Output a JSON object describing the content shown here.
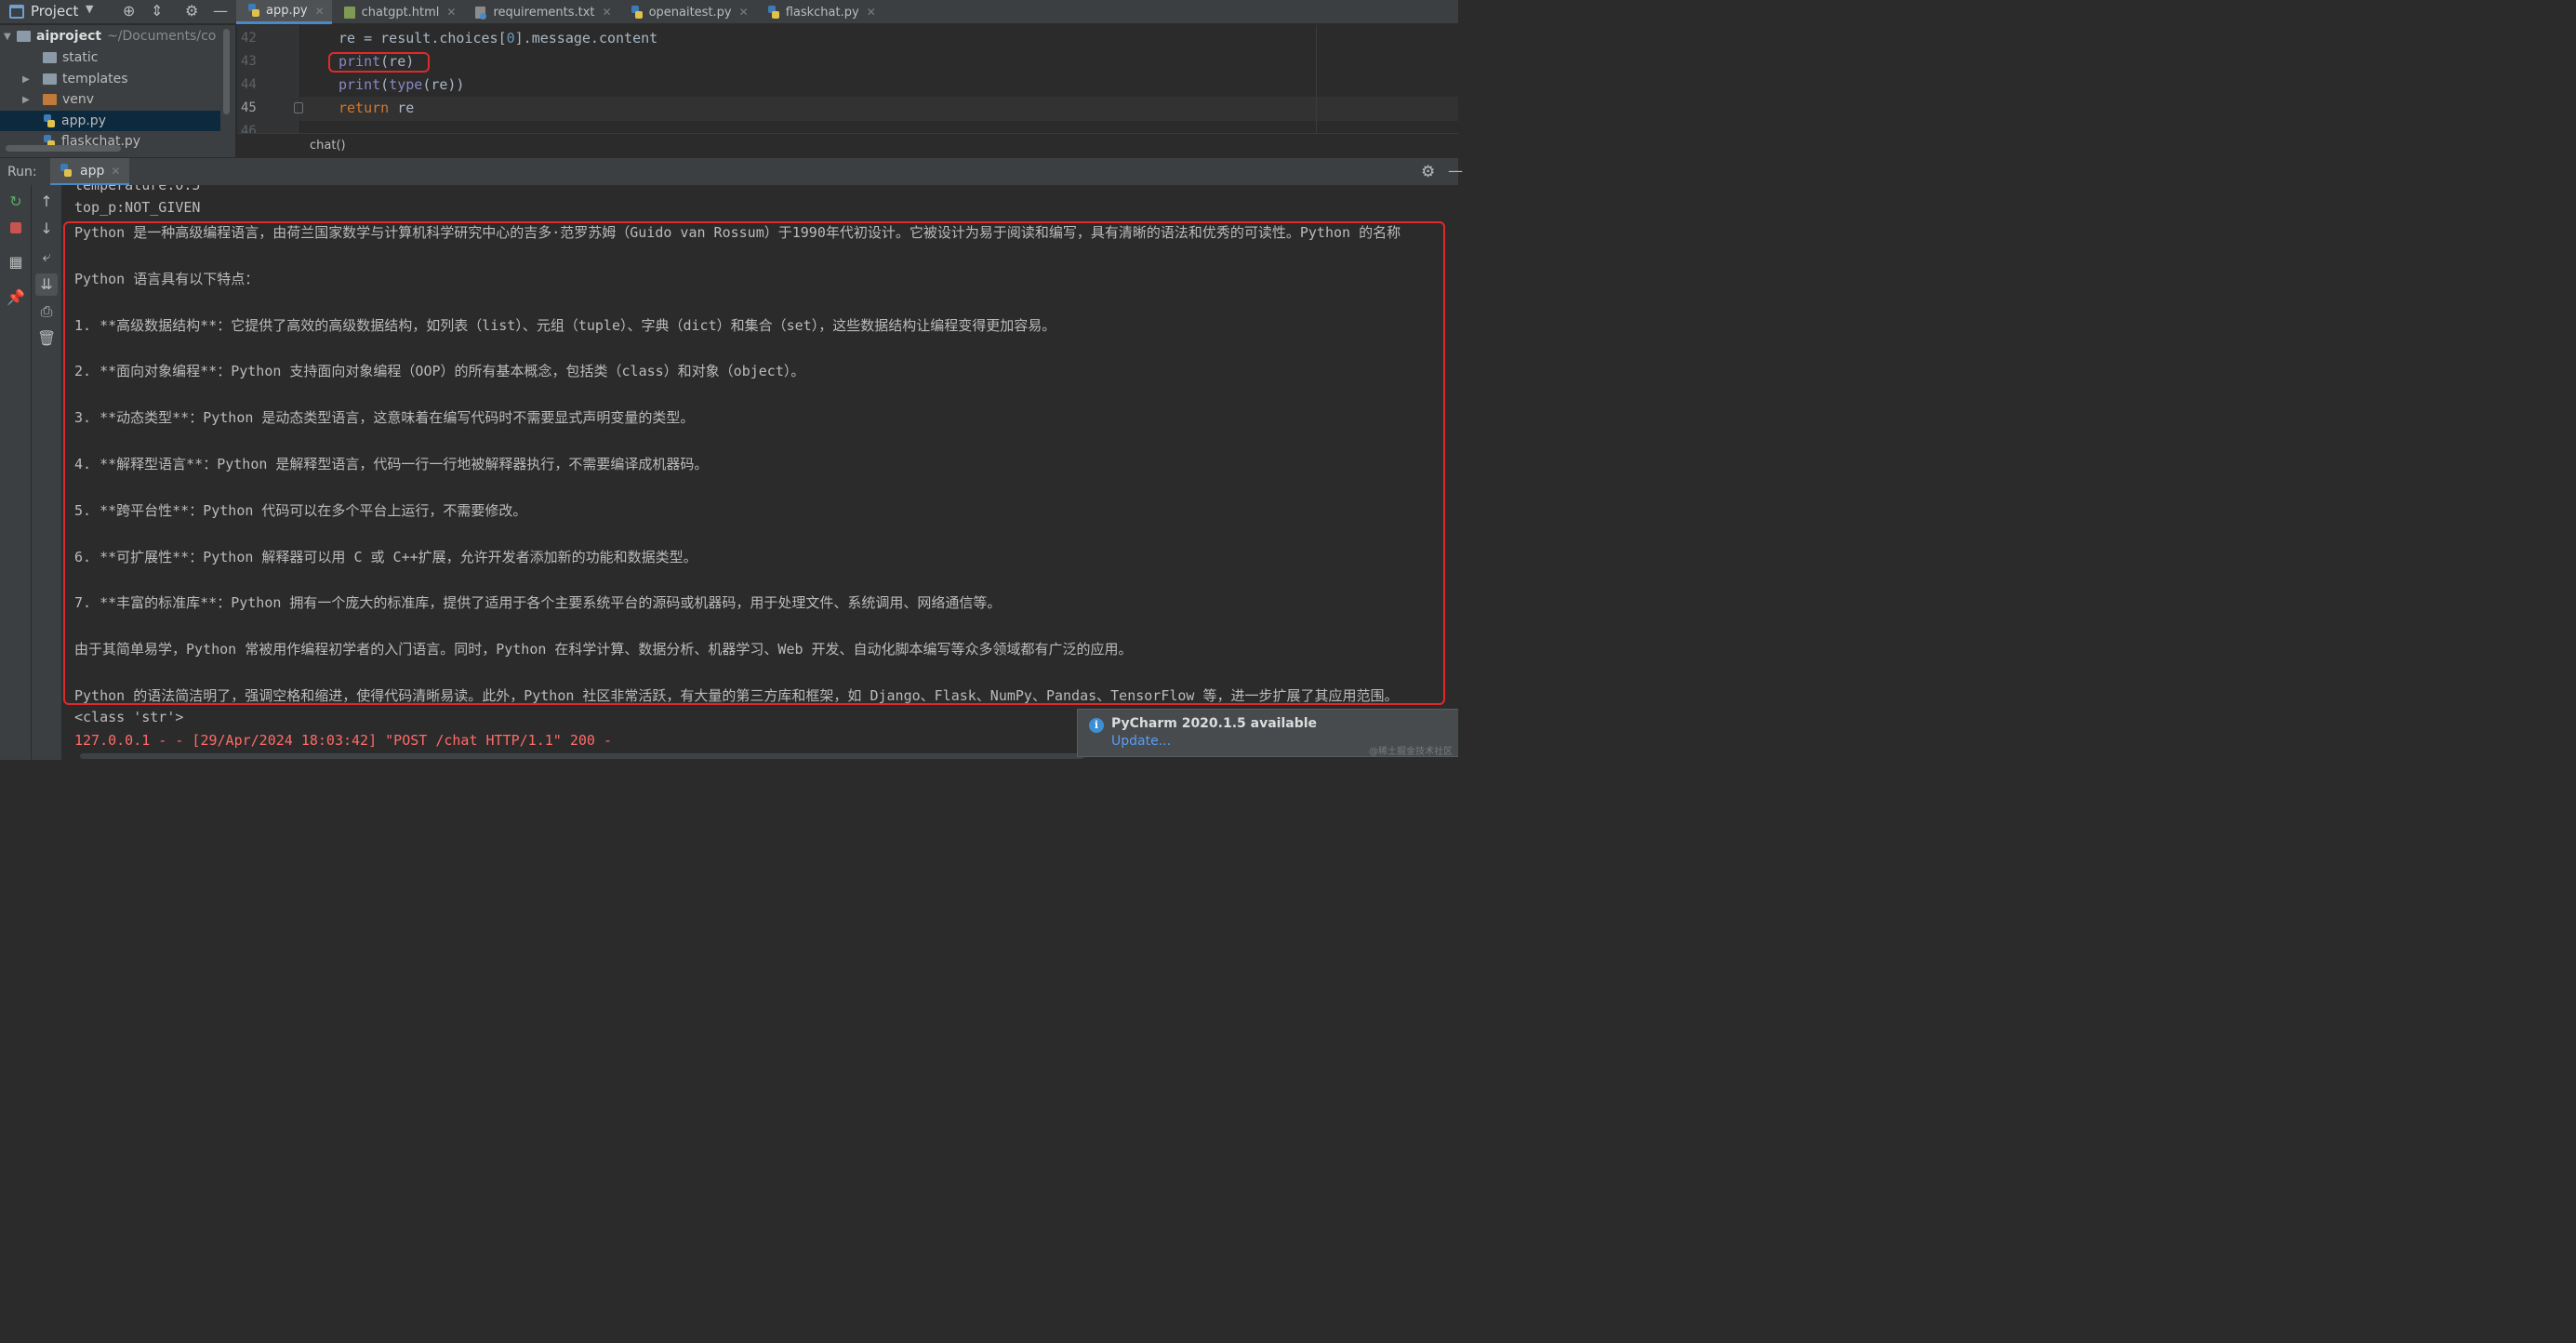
{
  "project_view": {
    "title": "Project",
    "tree": [
      {
        "label": "aiproject",
        "path": "~/Documents/co"
      },
      {
        "label": "static"
      },
      {
        "label": "templates"
      },
      {
        "label": "venv"
      },
      {
        "label": "app.py"
      },
      {
        "label": "flaskchat.py"
      }
    ]
  },
  "tabs": [
    {
      "label": "app.py",
      "icon": "python-file-icon",
      "active": true
    },
    {
      "label": "chatgpt.html",
      "icon": "html-file-icon"
    },
    {
      "label": "requirements.txt",
      "icon": "text-file-icon"
    },
    {
      "label": "openaitest.py",
      "icon": "python-file-icon"
    },
    {
      "label": "flaskchat.py",
      "icon": "python-file-icon"
    }
  ],
  "editor": {
    "line_numbers": [
      "42",
      "43",
      "44",
      "45",
      "46"
    ],
    "code": {
      "l42_pre": "re = result.choices[",
      "l42_num": "0",
      "l42_post": "].message.content",
      "l43_fn": "print",
      "l43_rest": "(re)",
      "l44_fn1": "print",
      "l44_mid": "(",
      "l44_fn2": "type",
      "l44_rest": "(re))",
      "l45_kw": "return",
      "l45_rest": " re"
    },
    "breadcrumb": "chat()"
  },
  "run": {
    "label": "Run:",
    "tab": "app",
    "console": {
      "partial_line": "temperature:0.5",
      "top_p": "top_p:NOT_GIVEN",
      "output": [
        "Python 是一种高级编程语言，由荷兰国家数学与计算机科学研究中心的吉多·范罗苏姆（Guido van Rossum）于1990年代初设计。它被设计为易于阅读和编写，具有清晰的语法和优秀的可读性。Python 的名称",
        "",
        "Python 语言具有以下特点：",
        "",
        "1. **高级数据结构**：它提供了高效的高级数据结构，如列表（list）、元组（tuple）、字典（dict）和集合（set），这些数据结构让编程变得更加容易。",
        "",
        "2. **面向对象编程**：Python 支持面向对象编程（OOP）的所有基本概念，包括类（class）和对象（object）。",
        "",
        "3. **动态类型**：Python 是动态类型语言，这意味着在编写代码时不需要显式声明变量的类型。",
        "",
        "4. **解释型语言**：Python 是解释型语言，代码一行一行地被解释器执行，不需要编译成机器码。",
        "",
        "5. **跨平台性**：Python 代码可以在多个平台上运行，不需要修改。",
        "",
        "6. **可扩展性**：Python 解释器可以用 C 或 C++扩展，允许开发者添加新的功能和数据类型。",
        "",
        "7. **丰富的标准库**：Python 拥有一个庞大的标准库，提供了适用于各个主要系统平台的源码或机器码，用于处理文件、系统调用、网络通信等。",
        "",
        "由于其简单易学，Python 常被用作编程初学者的入门语言。同时，Python 在科学计算、数据分析、机器学习、Web 开发、自动化脚本编写等众多领域都有广泛的应用。",
        "",
        "Python 的语法简洁明了，强调空格和缩进，使得代码清晰易读。此外，Python 社区非常活跃，有大量的第三方库和框架，如 Django、Flask、NumPy、Pandas、TensorFlow 等，进一步扩展了其应用范围。"
      ],
      "class_line": "<class 'str'>",
      "log_line": "127.0.0.1 - - [29/Apr/2024 18:03:42] \"POST /chat HTTP/1.1\" 200 -"
    }
  },
  "notification": {
    "title": "PyCharm 2020.1.5 available",
    "link": "Update...",
    "icon": "info-icon"
  },
  "watermark": "@稀土掘金技术社区",
  "colors": {
    "highlight_box": "#e02a2a",
    "accent": "#4a88c7",
    "error_text": "#ff6b68"
  }
}
